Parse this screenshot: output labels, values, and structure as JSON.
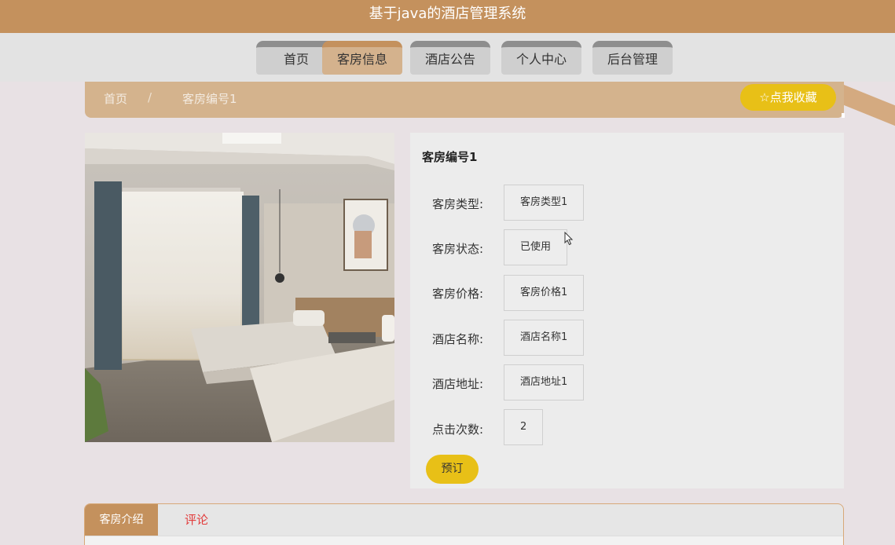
{
  "app": {
    "title": "基于java的酒店管理系统"
  },
  "nav": {
    "items": [
      {
        "label": "首页"
      },
      {
        "label": "客房信息"
      },
      {
        "label": "酒店公告"
      },
      {
        "label": "个人中心"
      },
      {
        "label": "后台管理"
      }
    ],
    "active_index": 1
  },
  "breadcrumb": {
    "home": "首页",
    "separator": "/",
    "current": "客房编号1"
  },
  "favorite": {
    "icon": "star-outline-icon",
    "label": "点我收藏"
  },
  "room": {
    "title": "客房编号1",
    "fields": [
      {
        "label": "客房类型:",
        "value": "客房类型1"
      },
      {
        "label": "客房状态:",
        "value": "已使用"
      },
      {
        "label": "客房价格:",
        "value": "客房价格1"
      },
      {
        "label": "酒店名称:",
        "value": "酒店名称1"
      },
      {
        "label": "酒店地址:",
        "value": "酒店地址1"
      },
      {
        "label": "点击次数:",
        "value": "2"
      }
    ],
    "book_label": "预订"
  },
  "tabs": {
    "intro": "客房介绍",
    "comment": "评论"
  },
  "colors": {
    "brand": "#c4915d",
    "accent": "#e8c017",
    "comment_tab": "#e23b3b"
  }
}
